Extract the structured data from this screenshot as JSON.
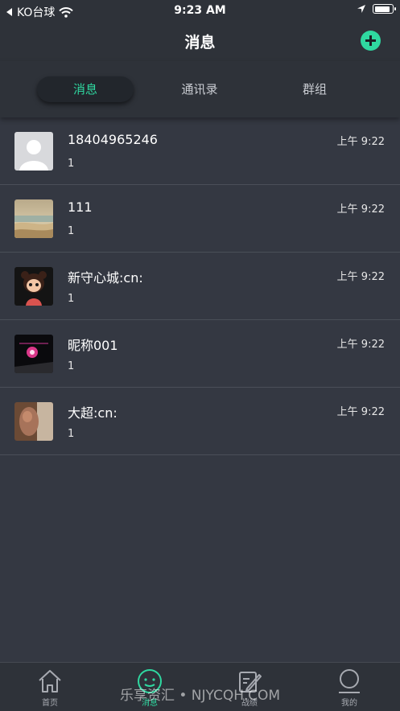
{
  "status_bar": {
    "back_app": "KO台球",
    "time": "9:23 AM",
    "battery_level": 0.9
  },
  "nav": {
    "title": "消息",
    "add_icon": "plus-circle-icon"
  },
  "tabs": [
    {
      "label": "消息",
      "active": true
    },
    {
      "label": "通讯录",
      "active": false
    },
    {
      "label": "群组",
      "active": false
    }
  ],
  "conversations": [
    {
      "name": "18404965246",
      "last_message": "1",
      "time": "上午 9:22",
      "avatar": "default-person-avatar"
    },
    {
      "name": "111",
      "last_message": "1",
      "time": "上午 9:22",
      "avatar": "beach-photo-avatar"
    },
    {
      "name": "新守心城:cn:",
      "last_message": "1",
      "time": "上午 9:22",
      "avatar": "cartoon-girl-avatar"
    },
    {
      "name": "昵称001",
      "last_message": "1",
      "time": "上午 9:22",
      "avatar": "concert-photo-avatar"
    },
    {
      "name": "大超:cn:",
      "last_message": "1",
      "time": "上午 9:22",
      "avatar": "photo-avatar"
    }
  ],
  "tabbar": [
    {
      "label": "首页",
      "icon": "home-icon",
      "active": false
    },
    {
      "label": "消息",
      "icon": "message-smile-icon",
      "active": true
    },
    {
      "label": "战绩",
      "icon": "record-icon",
      "active": false
    },
    {
      "label": "我的",
      "icon": "profile-icon",
      "active": false
    }
  ],
  "watermark": "乐享资汇 • NJYCQH.COM",
  "colors": {
    "accent": "#2fd8a0",
    "background": "#343842",
    "bar": "#2e3239"
  }
}
